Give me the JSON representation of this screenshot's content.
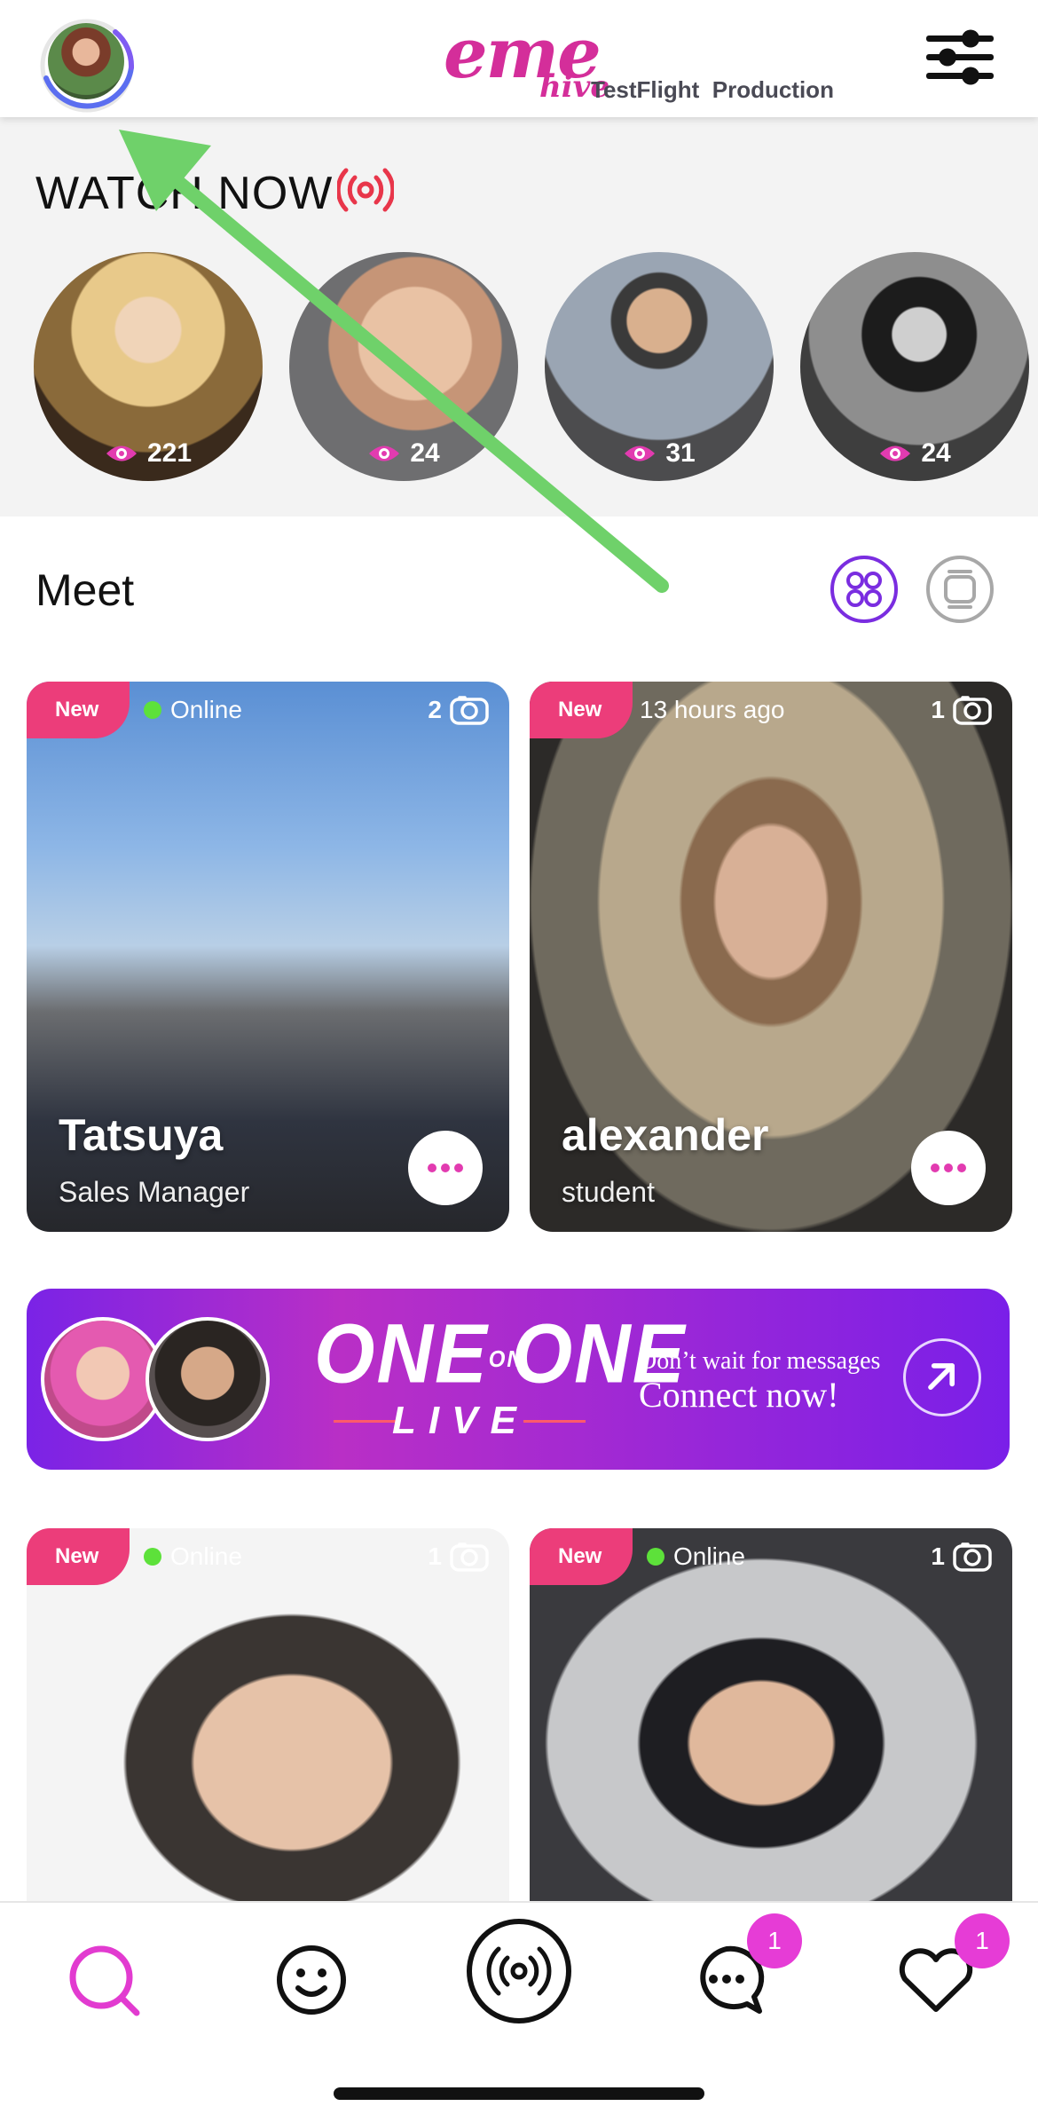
{
  "header": {
    "logo_main": "eme",
    "logo_sub": "hive",
    "build_label": "TestFlight",
    "env_label": "Production",
    "avatar_icon": "user-avatar",
    "filter_icon": "sliders-icon"
  },
  "watch_now": {
    "title": "WATCH NOW",
    "live_icon": "live-broadcast-icon",
    "streams": [
      {
        "viewers": "221"
      },
      {
        "viewers": "24"
      },
      {
        "viewers": "31"
      },
      {
        "viewers": "24"
      }
    ]
  },
  "meet": {
    "title": "Meet",
    "grid_view_icon": "grid-view-icon",
    "card_view_icon": "card-view-icon",
    "cards": [
      {
        "badge": "New",
        "status": "Online",
        "views": "2",
        "name": "Tatsuya",
        "job": "Sales Manager"
      },
      {
        "badge": "New",
        "status": "13 hours ago",
        "views": "1",
        "name": "alexander",
        "job": "student"
      },
      {
        "badge": "New",
        "status": "Online",
        "views": "1",
        "name": "",
        "job": ""
      },
      {
        "badge": "New",
        "status": "Online",
        "views": "1",
        "name": "",
        "job": ""
      }
    ]
  },
  "banner": {
    "one_a": "ONE",
    "on": "ON",
    "one_b": "ONE",
    "live": "LIVE",
    "tagline_small": "Don’t wait for messages",
    "tagline_big": "Connect now!"
  },
  "tabbar": {
    "messages_badge": "1",
    "likes_badge": "1"
  },
  "colors": {
    "brand_pink": "#d42e9a",
    "new_badge": "#ec3d7a",
    "online_dot": "#5de13a",
    "accent_purple": "#7a2de0",
    "tab_badge": "#e63cd6"
  }
}
